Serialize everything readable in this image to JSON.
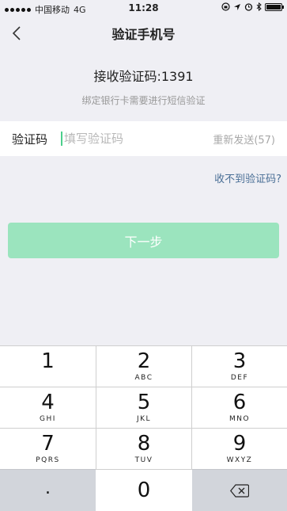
{
  "status_bar": {
    "carrier": "中国移动",
    "network": "4G",
    "time": "11:28"
  },
  "nav": {
    "title": "验证手机号",
    "back_icon": "chevron-left-icon"
  },
  "heading": "接收验证码:1391",
  "subheading": "绑定银行卡需要进行短信验证",
  "code_field": {
    "label": "验证码",
    "value": "",
    "placeholder": "填写验证码",
    "resend_label": "重新发送(57)"
  },
  "not_received_link": "收不到验证码?",
  "next_button": {
    "label": "下一步",
    "color": "#9be4be"
  },
  "keypad": {
    "keys": [
      {
        "num": "1",
        "letters": ""
      },
      {
        "num": "2",
        "letters": "ABC"
      },
      {
        "num": "3",
        "letters": "DEF"
      },
      {
        "num": "4",
        "letters": "GHI"
      },
      {
        "num": "5",
        "letters": "JKL"
      },
      {
        "num": "6",
        "letters": "MNO"
      },
      {
        "num": "7",
        "letters": "PQRS"
      },
      {
        "num": "8",
        "letters": "TUV"
      },
      {
        "num": "9",
        "letters": "WXYZ"
      },
      {
        "num": ".",
        "letters": ""
      },
      {
        "num": "0",
        "letters": ""
      }
    ],
    "delete_icon": "backspace-icon"
  },
  "colors": {
    "accent_green": "#4ccf8c",
    "link_blue": "#4a6f96",
    "background": "#efeff4"
  }
}
